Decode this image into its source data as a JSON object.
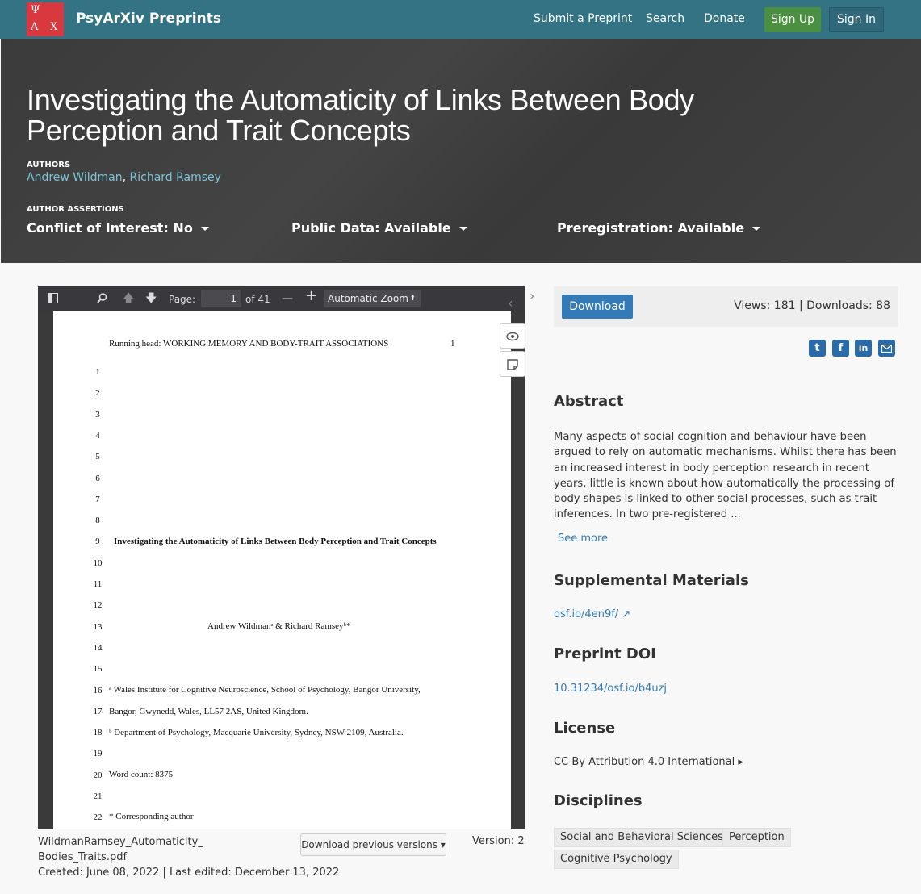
{
  "navbar": {
    "logo_letters": [
      "Ψ",
      "Α",
      "Χ"
    ],
    "brand": "PsyArXiv Preprints",
    "links": [
      "Submit a Preprint",
      "Search",
      "Donate"
    ],
    "sign_up": "Sign Up",
    "sign_in": "Sign In",
    "colors": {
      "navbar": "#337383",
      "sign_up": "#4a9040",
      "logo": "#d9383f"
    }
  },
  "header": {
    "title": "Investigating the Automaticity of Links Between Body Perception and Trait Concepts",
    "authors_label": "AUTHORS",
    "authors": [
      "Andrew Wildman",
      "Richard Ramsey"
    ],
    "author_separator": ", ",
    "assertions_label": "AUTHOR ASSERTIONS",
    "assertions": [
      "Conflict of Interest: No",
      "Public Data: Available",
      "Preregistration: Available"
    ]
  },
  "viewer": {
    "toolbar": {
      "sidebar_icon": "sidebar-toggle-icon",
      "find_icon": "search-icon",
      "page_label": "Page:",
      "page_value": "1",
      "page_total": "of 41",
      "zoom_out": "—",
      "zoom_in": "+",
      "zoom": "Automatic Zoom"
    },
    "side_tools": [
      "eye-icon",
      "note-icon"
    ],
    "page": {
      "running_head": "Running head: WORKING MEMORY AND BODY-TRAIT ASSOCIATIONS",
      "page_number": "1",
      "line_numbers": [
        "1",
        "2",
        "3",
        "4",
        "5",
        "6",
        "7",
        "8",
        "9",
        "10",
        "11",
        "12",
        "13",
        "14",
        "15",
        "16",
        "17",
        "18",
        "19",
        "20",
        "21",
        "22"
      ],
      "title": "Investigating the Automaticity of Links Between Body Perception and Trait Concepts",
      "authors": "Andrew Wildmanᵃ & Richard Ramseyᵇ*",
      "affil_a1": "ᵃ Wales Institute for Cognitive Neuroscience, School of Psychology, Bangor University,",
      "affil_a2": "Bangor, Gwynedd, Wales, LL57 2AS, United Kingdom.",
      "affil_b": "ᵇ Department of Psychology, Macquarie University, Sydney, NSW 2109, Australia.",
      "word_count": "Word count: 8375",
      "corresponding": "* Corresponding author"
    },
    "file_name_1": "WildmanRamsey_Automaticity_",
    "file_name_2": "Bodies_Traits.pdf",
    "dates": "Created: June 08, 2022 | Last edited: December 13, 2022",
    "prev_versions": "Download previous versions ▾",
    "version": "Version: 2"
  },
  "sidebar": {
    "download": "Download",
    "stats": "Views: 181 | Downloads: 88",
    "share_icons": [
      "twitter-icon",
      "facebook-icon",
      "linkedin-icon",
      "email-icon"
    ],
    "abstract_heading": "Abstract",
    "abstract": "Many aspects of social cognition and behaviour have been argued to rely on automatic mechanisms. Whilst there has been an increased interest in body perception research in recent years, little is known about how automatically the processing of body shapes is linked to other social processes, such as trait inferences. In two pre-registered ...",
    "see_more": "See more",
    "supplemental_heading": "Supplemental Materials",
    "supplemental_link": "osf.io/4en9f/",
    "doi_heading": "Preprint DOI",
    "doi": "10.31234/osf.io/b4uzj",
    "license_heading": "License",
    "license": "CC-By Attribution 4.0 International ▸",
    "disciplines_heading": "Disciplines",
    "disciplines": [
      "Social and Behavioral Sciences",
      "Perception",
      "Cognitive Psychology"
    ]
  }
}
